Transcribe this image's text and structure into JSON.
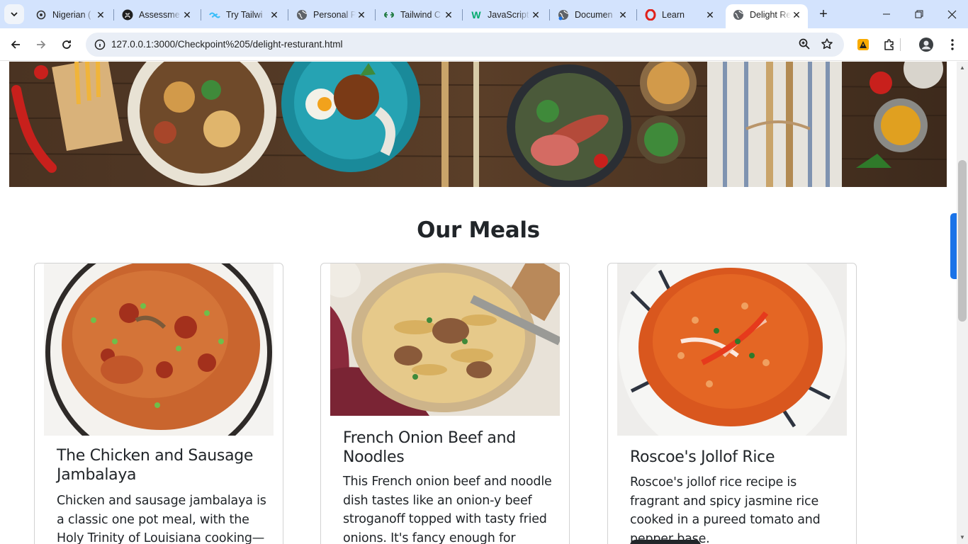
{
  "browser": {
    "tabs": [
      {
        "title": "Nigerian (",
        "icon": "openai-icon"
      },
      {
        "title": "Assessme",
        "icon": "github-icon"
      },
      {
        "title": "Try Tailwi",
        "icon": "tailwind-icon"
      },
      {
        "title": "Personal P",
        "icon": "globe-icon"
      },
      {
        "title": "Tailwind C",
        "icon": "link-icon"
      },
      {
        "title": "JavaScript",
        "icon": "w3schools-icon"
      },
      {
        "title": "Documen",
        "icon": "globe-icon"
      },
      {
        "title": "Learn",
        "icon": "opera-icon"
      },
      {
        "title": "Delight Re",
        "icon": "globe-icon",
        "active": true
      }
    ],
    "url": "127.0.0.1:3000/Checkpoint%205/delight-resturant.html",
    "accent": "#1a73e8",
    "tabbar_color": "#d3e3fd"
  },
  "page": {
    "hero_alt": "Food table banner",
    "section_title": "Our Meals",
    "cards": [
      {
        "title": "The Chicken and Sausage Jambalaya",
        "text": "Chicken and sausage jambalaya is a classic one pot meal, with the Holy Trinity of Louisiana cooking—celery,"
      },
      {
        "title": "French Onion Beef and Noodles",
        "text": "This French onion beef and noodle dish tastes like an onion-y beef stroganoff topped with tasty fried onions. It's fancy enough for adults"
      },
      {
        "title": "Roscoe's Jollof Rice",
        "text": "Roscoe's jollof rice recipe is fragrant and spicy jasmine rice cooked in a pureed tomato and pepper base."
      }
    ]
  }
}
